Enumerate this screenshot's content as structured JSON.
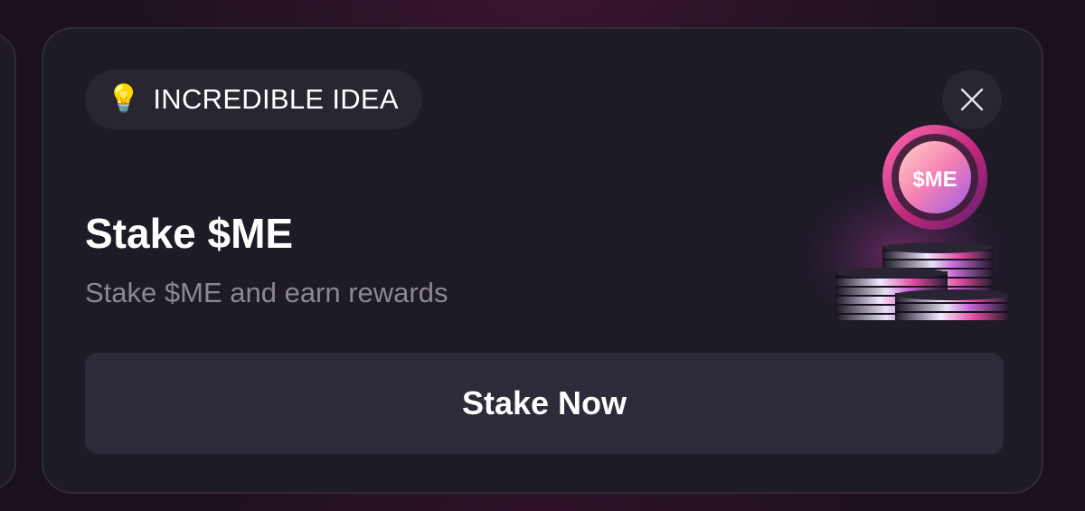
{
  "card": {
    "tag": {
      "icon": "lightbulb-icon",
      "glyph": "💡",
      "label": "INCREDIBLE IDEA"
    },
    "close": {
      "icon": "close-icon"
    },
    "title": "Stake $ME",
    "subtitle": "Stake $ME and earn rewards",
    "illustration": {
      "icon": "coin-stack-icon",
      "coin_label": "$ME"
    },
    "cta_label": "Stake Now"
  },
  "colors": {
    "background": "#1a111d",
    "card": "#1e1a26",
    "pill": "#2a2631",
    "button": "#2e2a38",
    "text_primary": "#ffffff",
    "text_secondary": "#8c8794",
    "accent_pink": "#e84a9c",
    "accent_purple": "#8a4fe0"
  }
}
